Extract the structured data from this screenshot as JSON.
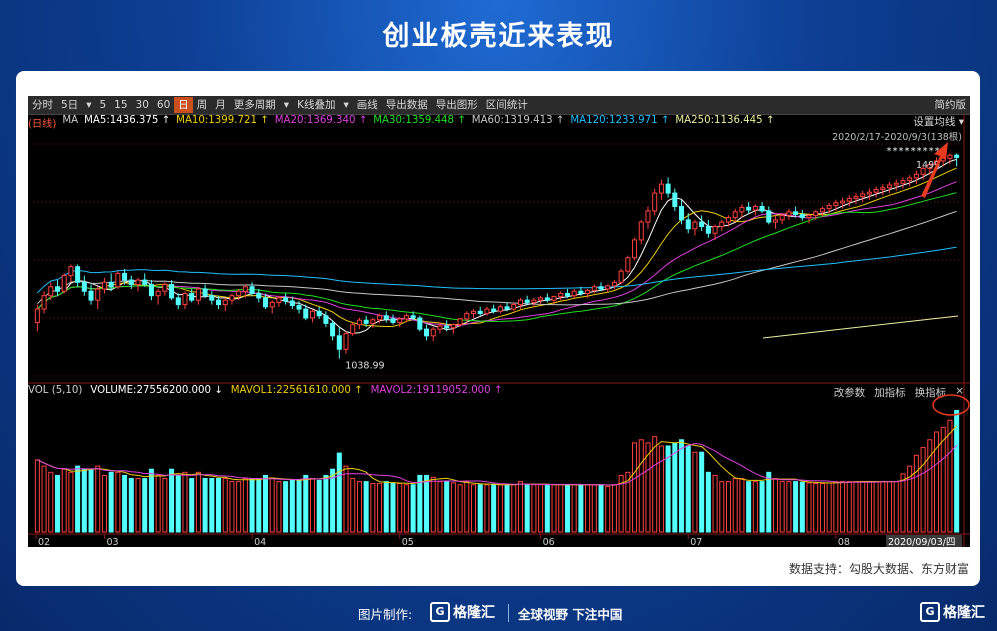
{
  "title": "创业板壳近来表现",
  "toolbar": {
    "items": [
      "分时",
      "5日",
      "▾",
      "5",
      "15",
      "30",
      "60",
      "日",
      "周",
      "月",
      "更多周期",
      "▾",
      "K线叠加",
      "▾",
      "画线",
      "导出数据",
      "导出图形",
      "区间统计"
    ],
    "active": "日",
    "right": "简约版"
  },
  "price_legend": {
    "period": "(日线)",
    "ma": "MA",
    "items": [
      {
        "label": "MA5:1436.375",
        "color": "#ffffff"
      },
      {
        "label": "MA10:1399.721",
        "color": "#f0d000"
      },
      {
        "label": "MA20:1369.340",
        "color": "#e040e0"
      },
      {
        "label": "MA30:1359.448",
        "color": "#20e020"
      },
      {
        "label": "MA60:1319.413",
        "color": "#c8c8c8"
      },
      {
        "label": "MA120:1233.971",
        "color": "#20c0ff"
      },
      {
        "label": "MA250:1136.445",
        "color": "#f0f0a0"
      }
    ],
    "ma_setting": "设置均线",
    "range": "2020/2/17-2020/9/3(138根)",
    "high_label": "1499",
    "low_label": "1038.99",
    "stars": "*********"
  },
  "volume_legend": {
    "label": "VOL (5,10)",
    "volume": "VOLUME:27556200.000",
    "mavol1": "MAVOL1:22561610.000",
    "mavol2": "MAVOL2:19119052.000",
    "buttons": [
      "改参数",
      "加指标",
      "换指标",
      "×"
    ]
  },
  "x_axis": {
    "labels": [
      "02",
      "03",
      "04",
      "05",
      "06",
      "07",
      "08"
    ],
    "date_box": "2020/09/03/四"
  },
  "credit": "数据支持：勾股大数据、东方财富",
  "footer": {
    "made_by": "图片制作:",
    "brand": "格隆汇",
    "slogan": "全球视野 下注中国",
    "corner_brand": "格隆汇"
  },
  "colors": {
    "up": "#ff4040",
    "down": "#54ffff",
    "arrow": "#e83a20",
    "circle": "#e83a20"
  },
  "chart_data": {
    "type": "candlestick",
    "title": "创业板壳近来表现",
    "period": "2020/2/17-2020/9/3",
    "bars": 138,
    "ylim": [
      1000,
      1520
    ],
    "ohlc": [
      [
        1120,
        1160,
        1100,
        1150
      ],
      [
        1150,
        1190,
        1140,
        1180
      ],
      [
        1180,
        1210,
        1170,
        1200
      ],
      [
        1200,
        1215,
        1180,
        1190
      ],
      [
        1190,
        1230,
        1185,
        1225
      ],
      [
        1225,
        1250,
        1210,
        1245
      ],
      [
        1245,
        1250,
        1200,
        1210
      ],
      [
        1210,
        1225,
        1180,
        1190
      ],
      [
        1190,
        1205,
        1160,
        1170
      ],
      [
        1170,
        1200,
        1150,
        1195
      ],
      [
        1195,
        1220,
        1185,
        1210
      ],
      [
        1210,
        1230,
        1190,
        1200
      ],
      [
        1200,
        1235,
        1195,
        1230
      ],
      [
        1230,
        1240,
        1205,
        1215
      ],
      [
        1215,
        1225,
        1195,
        1205
      ],
      [
        1205,
        1220,
        1190,
        1215
      ],
      [
        1215,
        1230,
        1200,
        1205
      ],
      [
        1205,
        1215,
        1170,
        1180
      ],
      [
        1180,
        1195,
        1160,
        1190
      ],
      [
        1190,
        1210,
        1180,
        1205
      ],
      [
        1205,
        1215,
        1170,
        1175
      ],
      [
        1175,
        1185,
        1150,
        1160
      ],
      [
        1160,
        1190,
        1150,
        1185
      ],
      [
        1185,
        1195,
        1165,
        1170
      ],
      [
        1170,
        1200,
        1160,
        1195
      ],
      [
        1195,
        1205,
        1175,
        1180
      ],
      [
        1180,
        1190,
        1160,
        1170
      ],
      [
        1170,
        1180,
        1150,
        1160
      ],
      [
        1160,
        1175,
        1145,
        1170
      ],
      [
        1170,
        1185,
        1160,
        1180
      ],
      [
        1180,
        1195,
        1170,
        1190
      ],
      [
        1190,
        1205,
        1175,
        1200
      ],
      [
        1200,
        1210,
        1180,
        1185
      ],
      [
        1185,
        1195,
        1165,
        1175
      ],
      [
        1175,
        1185,
        1150,
        1155
      ],
      [
        1155,
        1170,
        1140,
        1165
      ],
      [
        1165,
        1180,
        1155,
        1175
      ],
      [
        1175,
        1185,
        1160,
        1168
      ],
      [
        1168,
        1178,
        1150,
        1158
      ],
      [
        1158,
        1168,
        1140,
        1150
      ],
      [
        1150,
        1160,
        1125,
        1130
      ],
      [
        1130,
        1150,
        1120,
        1145
      ],
      [
        1145,
        1155,
        1128,
        1135
      ],
      [
        1135,
        1145,
        1110,
        1118
      ],
      [
        1118,
        1125,
        1080,
        1090
      ],
      [
        1090,
        1110,
        1039,
        1060
      ],
      [
        1060,
        1100,
        1050,
        1095
      ],
      [
        1095,
        1120,
        1090,
        1115
      ],
      [
        1115,
        1130,
        1105,
        1125
      ],
      [
        1125,
        1135,
        1110,
        1118
      ],
      [
        1118,
        1130,
        1108,
        1126
      ],
      [
        1126,
        1140,
        1118,
        1135
      ],
      [
        1135,
        1145,
        1120,
        1128
      ],
      [
        1128,
        1138,
        1115,
        1120
      ],
      [
        1120,
        1132,
        1110,
        1128
      ],
      [
        1128,
        1140,
        1120,
        1135
      ],
      [
        1135,
        1145,
        1125,
        1130
      ],
      [
        1130,
        1135,
        1100,
        1105
      ],
      [
        1105,
        1115,
        1080,
        1090
      ],
      [
        1090,
        1110,
        1078,
        1105
      ],
      [
        1105,
        1120,
        1095,
        1112
      ],
      [
        1112,
        1125,
        1100,
        1108
      ],
      [
        1108,
        1118,
        1095,
        1115
      ],
      [
        1115,
        1130,
        1110,
        1128
      ],
      [
        1128,
        1145,
        1120,
        1140
      ],
      [
        1140,
        1150,
        1130,
        1145
      ],
      [
        1145,
        1155,
        1135,
        1140
      ],
      [
        1140,
        1155,
        1135,
        1150
      ],
      [
        1150,
        1160,
        1140,
        1145
      ],
      [
        1145,
        1160,
        1140,
        1155
      ],
      [
        1155,
        1165,
        1145,
        1150
      ],
      [
        1150,
        1165,
        1145,
        1160
      ],
      [
        1160,
        1175,
        1150,
        1170
      ],
      [
        1170,
        1180,
        1160,
        1165
      ],
      [
        1165,
        1175,
        1155,
        1170
      ],
      [
        1170,
        1180,
        1160,
        1175
      ],
      [
        1175,
        1185,
        1165,
        1170
      ],
      [
        1170,
        1180,
        1160,
        1178
      ],
      [
        1178,
        1190,
        1170,
        1185
      ],
      [
        1185,
        1195,
        1175,
        1180
      ],
      [
        1180,
        1195,
        1175,
        1190
      ],
      [
        1190,
        1200,
        1180,
        1185
      ],
      [
        1185,
        1195,
        1175,
        1192
      ],
      [
        1192,
        1205,
        1185,
        1200
      ],
      [
        1200,
        1210,
        1190,
        1195
      ],
      [
        1195,
        1205,
        1188,
        1202
      ],
      [
        1202,
        1215,
        1195,
        1210
      ],
      [
        1210,
        1240,
        1205,
        1235
      ],
      [
        1235,
        1270,
        1230,
        1265
      ],
      [
        1265,
        1310,
        1260,
        1305
      ],
      [
        1305,
        1350,
        1295,
        1345
      ],
      [
        1345,
        1380,
        1330,
        1370
      ],
      [
        1370,
        1420,
        1360,
        1410
      ],
      [
        1410,
        1440,
        1395,
        1430
      ],
      [
        1430,
        1445,
        1400,
        1410
      ],
      [
        1410,
        1420,
        1370,
        1380
      ],
      [
        1380,
        1395,
        1340,
        1350
      ],
      [
        1350,
        1365,
        1320,
        1330
      ],
      [
        1330,
        1350,
        1315,
        1345
      ],
      [
        1345,
        1360,
        1325,
        1335
      ],
      [
        1335,
        1350,
        1310,
        1320
      ],
      [
        1320,
        1340,
        1305,
        1335
      ],
      [
        1335,
        1350,
        1325,
        1345
      ],
      [
        1345,
        1360,
        1335,
        1355
      ],
      [
        1355,
        1375,
        1345,
        1368
      ],
      [
        1368,
        1385,
        1355,
        1378
      ],
      [
        1378,
        1390,
        1365,
        1372
      ],
      [
        1372,
        1385,
        1360,
        1380
      ],
      [
        1380,
        1390,
        1365,
        1370
      ],
      [
        1370,
        1380,
        1340,
        1345
      ],
      [
        1345,
        1360,
        1330,
        1350
      ],
      [
        1350,
        1365,
        1340,
        1360
      ],
      [
        1360,
        1375,
        1350,
        1368
      ],
      [
        1368,
        1380,
        1355,
        1362
      ],
      [
        1362,
        1372,
        1348,
        1355
      ],
      [
        1355,
        1365,
        1342,
        1360
      ],
      [
        1360,
        1372,
        1350,
        1368
      ],
      [
        1368,
        1380,
        1358,
        1375
      ],
      [
        1375,
        1388,
        1365,
        1382
      ],
      [
        1382,
        1395,
        1370,
        1388
      ],
      [
        1388,
        1400,
        1375,
        1392
      ],
      [
        1392,
        1405,
        1380,
        1398
      ],
      [
        1398,
        1410,
        1385,
        1402
      ],
      [
        1402,
        1415,
        1390,
        1408
      ],
      [
        1408,
        1420,
        1395,
        1412
      ],
      [
        1412,
        1425,
        1400,
        1418
      ],
      [
        1418,
        1430,
        1405,
        1422
      ],
      [
        1422,
        1435,
        1410,
        1428
      ],
      [
        1428,
        1440,
        1415,
        1432
      ],
      [
        1432,
        1445,
        1420,
        1438
      ],
      [
        1438,
        1450,
        1425,
        1444
      ],
      [
        1444,
        1460,
        1430,
        1452
      ],
      [
        1452,
        1470,
        1440,
        1465
      ],
      [
        1465,
        1480,
        1450,
        1474
      ],
      [
        1474,
        1490,
        1460,
        1482
      ],
      [
        1482,
        1495,
        1470,
        1488
      ],
      [
        1488,
        1499,
        1475,
        1495
      ],
      [
        1495,
        1499,
        1470,
        1490
      ]
    ],
    "volume_ylim": [
      0,
      32000000
    ]
  }
}
